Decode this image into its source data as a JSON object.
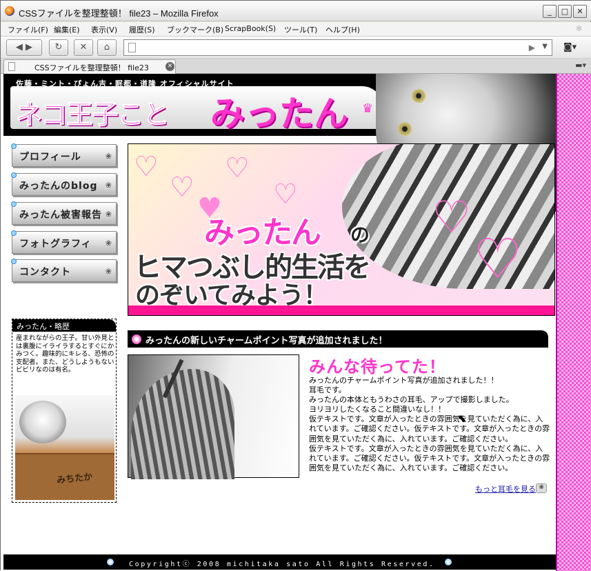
{
  "window": {
    "title": "CSSファイルを整理整頓！ file23 – Mozilla Firefox",
    "minimize": "_",
    "maximize": "□",
    "close": "✕"
  },
  "menu": [
    "ファイル(F)",
    "編集(E)",
    "表示(V)",
    "履歴(S)",
    "ブックマーク(B)",
    "ScrapBook(S)",
    "ツール(T)",
    "ヘルプ(H)"
  ],
  "nav": {
    "back": "◀ ▶",
    "reload": "↻",
    "stop": "✕",
    "home": "⌂",
    "url": "",
    "go": "▶",
    "dropdown": "▼"
  },
  "tabs": [
    {
      "label": "CSSファイルを整理整頓！ file23"
    }
  ],
  "site": {
    "subtitle": "佐藤・ミント・ぴょん吉・眠都・道隆 オフィシャルサイト",
    "logo_part1": "ネコ王子こと",
    "logo_part2": "みったん",
    "nav_items": [
      {
        "label": "プロフィール"
      },
      {
        "label": "みったんのblog"
      },
      {
        "label": "みったん被害報告"
      },
      {
        "label": "フォトグラフィ"
      },
      {
        "label": "コンタクト"
      }
    ],
    "hero": {
      "line1a": "みったん",
      "line1b": "の",
      "line2": "ヒマつぶし的生活を",
      "line3": "のぞいてみよう！"
    },
    "profile": {
      "heading": "みったん・略歴",
      "text": "産まれながらの王子。甘い外見とは裏腹にイライラするとすぐにかみつく。趣味的にキレる、恐怖の支配者。また、どうしようもないビビリなのは有名。",
      "box_text": "みちたか"
    },
    "news": {
      "bar_title": "みったんの新しいチャームポイント写真が追加されました！",
      "headline": "みんな待ってた！",
      "paragraphs": [
        "みったんのチャームポイント写真が追加されました！！",
        "耳毛です。",
        "みったんの本体ともうわさの耳毛、アップで撮影しました。",
        "ヨリヨリしたくなること間違いなし！！",
        "仮テキストです。文章が入ったときの雰囲気を見ていただく為に、入れています。ご確認ください。仮テキストです。文章が入ったときの雰囲気を見ていただく為に、入れています。ご確認ください。",
        "仮テキストです。文章が入ったときの雰囲気を見ていただく為に、入れています。ご確認ください。仮テキストです。文章が入ったときの雰囲気を見ていただく為に、入れています。ご確認ください。"
      ],
      "more_link": "もっと耳毛を見る"
    },
    "footer": "Copyrightⓒ 2008 michitaka sato All Rights Reserved."
  }
}
